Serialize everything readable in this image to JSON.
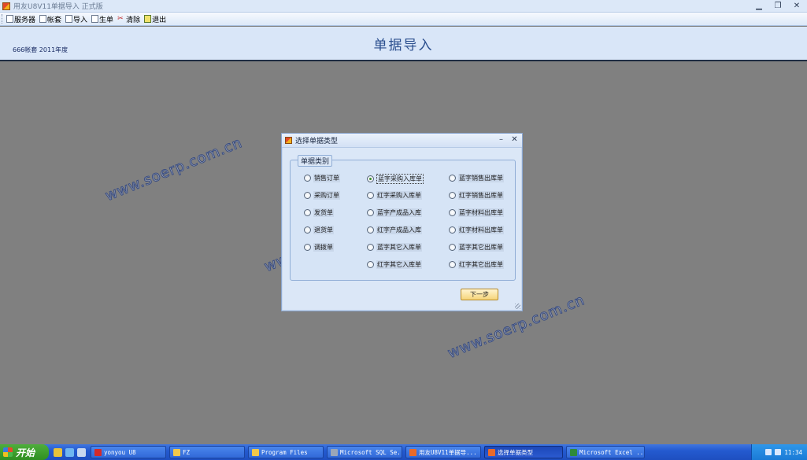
{
  "window": {
    "title": "用友U8V11单据导入  正式版"
  },
  "toolbar": {
    "items": [
      {
        "label": "服务器"
      },
      {
        "label": "帐套"
      },
      {
        "label": "导入"
      },
      {
        "label": "生单"
      },
      {
        "label": "清除"
      },
      {
        "label": "退出"
      }
    ]
  },
  "header": {
    "account": "666帐套  2011年度",
    "title": "单据导入"
  },
  "watermark": "www.soerp.com.cn",
  "dialog": {
    "title": "选择单据类型",
    "group_label": "单据类别",
    "selected": "蓝字采购入库单",
    "options": [
      "销售订单",
      "蓝字采购入库单",
      "蓝字销售出库单",
      "采购订单",
      "红字采购入库单",
      "红字销售出库单",
      "发货单",
      "蓝字产成品入库",
      "蓝字材料出库单",
      "退货单",
      "红字产成品入库",
      "红字材料出库单",
      "调拨单",
      "蓝字其它入库单",
      "蓝字其它出库单",
      "红字其它入库单",
      "红字其它出库单"
    ],
    "next_label": "下一步"
  },
  "taskbar": {
    "start_label": "开始",
    "tasks": [
      {
        "label": "yonyou U8",
        "icon_color": "#d42a2a"
      },
      {
        "label": "FZ",
        "icon_color": "#f2c84a"
      },
      {
        "label": "Program Files",
        "icon_color": "#f2c84a"
      },
      {
        "label": "Microsoft SQL Se...",
        "icon_color": "#9aa6b8"
      },
      {
        "label": "用友U8V11单据导...",
        "icon_color": "#e86a2a"
      },
      {
        "label": "选择单据类型",
        "icon_color": "#e86a2a"
      },
      {
        "label": "Microsoft Excel ...",
        "icon_color": "#2e8a3a"
      }
    ],
    "clock": "11:34"
  }
}
